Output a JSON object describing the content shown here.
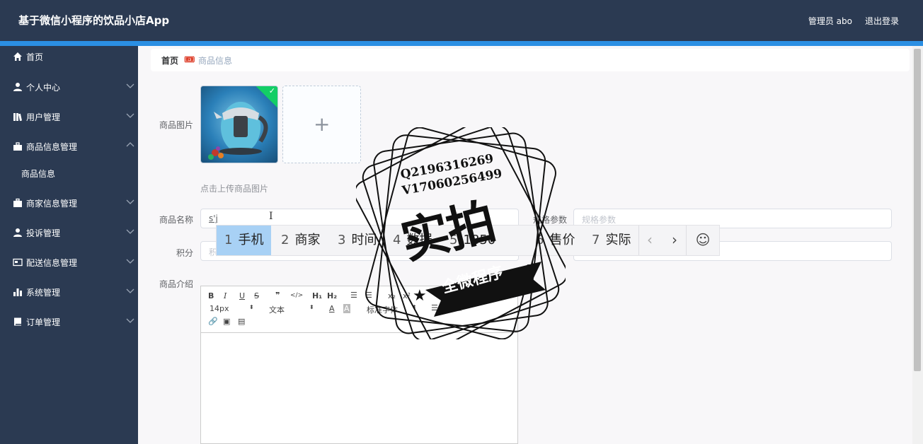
{
  "header": {
    "app_title": "基于微信小程序的饮品小店App",
    "user_label": "管理员 abo",
    "logout_label": "退出登录"
  },
  "sidebar": {
    "items": [
      {
        "label": "首页",
        "icon": "home-icon"
      },
      {
        "label": "个人中心",
        "icon": "user-icon"
      },
      {
        "label": "用户管理",
        "icon": "library-icon"
      },
      {
        "label": "商品信息管理",
        "icon": "bag-icon"
      },
      {
        "label": "商家信息管理",
        "icon": "briefcase-icon"
      },
      {
        "label": "投诉管理",
        "icon": "user-icon"
      },
      {
        "label": "配送信息管理",
        "icon": "card-icon"
      },
      {
        "label": "系统管理",
        "icon": "bar-chart-icon"
      },
      {
        "label": "订单管理",
        "icon": "book-icon"
      }
    ],
    "sub_item": "商品信息"
  },
  "breadcrumb": {
    "home": "首页",
    "separator": "🎟",
    "current": "商品信息"
  },
  "form": {
    "image_label": "商品图片",
    "upload_tip": "点击上传商品图片",
    "name_label": "商品名称",
    "name_value": "s'j",
    "spec_label": "规格参数",
    "spec_placeholder": "规格参数",
    "points_label": "积分",
    "points_placeholder": "积",
    "intro_label": "商品介绍"
  },
  "ime": {
    "candidates": [
      {
        "num": "1",
        "text": "手机"
      },
      {
        "num": "2",
        "text": "商家"
      },
      {
        "num": "3",
        "text": "时间"
      },
      {
        "num": "4",
        "text": "数据"
      },
      {
        "num": "5",
        "text": "1850"
      },
      {
        "num": "6",
        "text": "售价"
      },
      {
        "num": "7",
        "text": "实际"
      }
    ],
    "prev": "‹",
    "next": "›",
    "emoji": "☺"
  },
  "editor": {
    "font_size": "14px",
    "paragraph": "文本",
    "font_family": "标准字体",
    "bold": "B",
    "italic": "I",
    "underline": "U",
    "strike": "S",
    "quote": "❞",
    "code": "</>",
    "h1": "H₁",
    "h2": "H₂",
    "sub": "x₂",
    "sup": "x²",
    "clean": "Tₓ"
  },
  "watermark": {
    "qq": "Q2196316269",
    "phone": "V17060256499",
    "big": "实拍",
    "ribbon": "全微程序"
  },
  "colors": {
    "header_bg": "#2b3a52",
    "accent_stripe": "#2b8fe3",
    "success": "#13ce66",
    "ime_selected": "#a8d1f5"
  }
}
